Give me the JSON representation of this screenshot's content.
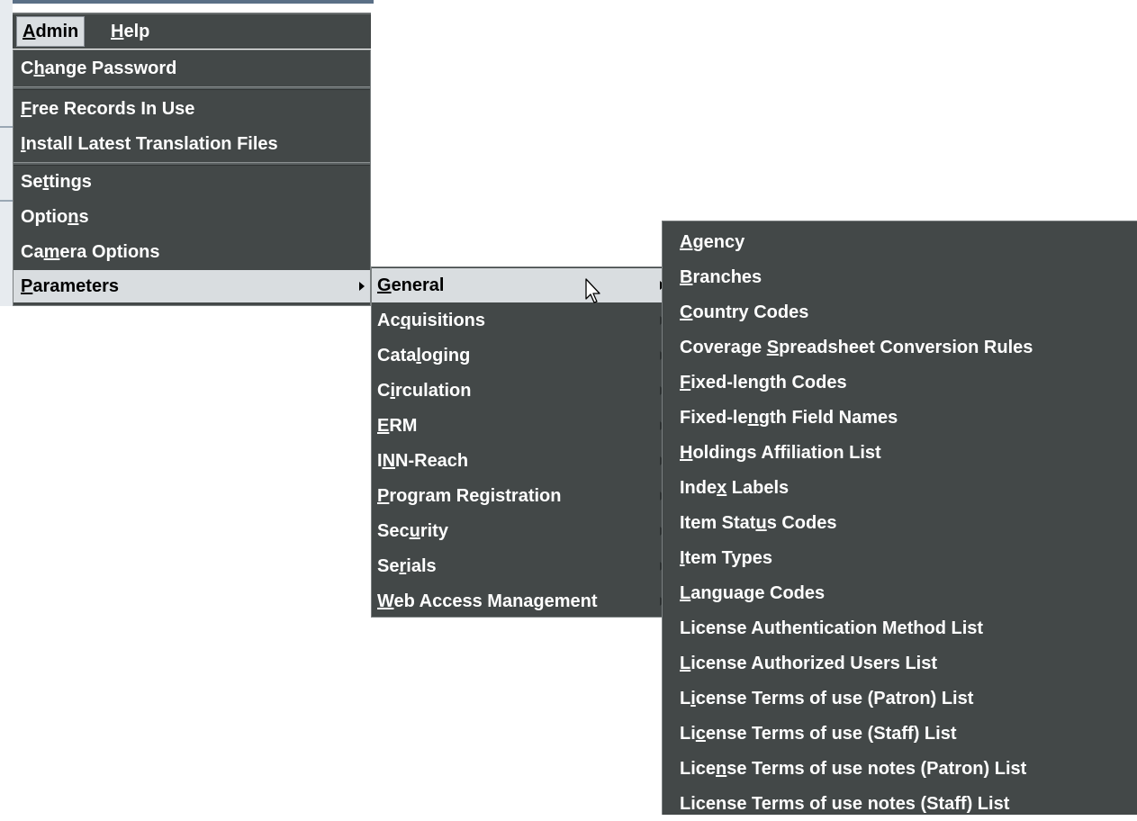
{
  "menubar": [
    {
      "pre": "",
      "mn": "A",
      "post": "dmin"
    },
    {
      "pre": "",
      "mn": "H",
      "post": "elp"
    }
  ],
  "admin_menu": {
    "change_password": {
      "pre": "C",
      "mn": "h",
      "post": "ange Password"
    },
    "free_records": {
      "pre": "",
      "mn": "F",
      "post": "ree Records In Use"
    },
    "install_translation": {
      "pre": "",
      "mn": "I",
      "post": "nstall Latest Translation Files"
    },
    "settings": {
      "pre": "Se",
      "mn": "t",
      "post": "tings"
    },
    "options": {
      "pre": "Optio",
      "mn": "n",
      "post": "s"
    },
    "camera_options": {
      "pre": "Ca",
      "mn": "m",
      "post": "era Options"
    },
    "parameters": {
      "pre": "",
      "mn": "P",
      "post": "arameters"
    }
  },
  "parameters_menu": [
    {
      "pre": "",
      "mn": "G",
      "post": "eneral"
    },
    {
      "pre": "Ac",
      "mn": "q",
      "post": "uisitions"
    },
    {
      "pre": "Cata",
      "mn": "l",
      "post": "oging"
    },
    {
      "pre": "C",
      "mn": "i",
      "post": "rculation"
    },
    {
      "pre": "",
      "mn": "E",
      "post": "RM"
    },
    {
      "pre": "I",
      "mn": "N",
      "post": "N-Reach"
    },
    {
      "pre": "",
      "mn": "P",
      "post": "rogram Registration"
    },
    {
      "pre": "Sec",
      "mn": "u",
      "post": "rity"
    },
    {
      "pre": "Se",
      "mn": "r",
      "post": "ials"
    },
    {
      "pre": "",
      "mn": "W",
      "post": "eb Access Management"
    }
  ],
  "general_menu": [
    {
      "pre": "",
      "mn": "A",
      "post": "gency"
    },
    {
      "pre": "",
      "mn": "B",
      "post": "ranches"
    },
    {
      "pre": "",
      "mn": "C",
      "post": "ountry Codes"
    },
    {
      "pre": "Coverage ",
      "mn": "S",
      "post": "preadsheet Conversion Rules"
    },
    {
      "pre": "",
      "mn": "F",
      "post": "ixed-length Codes"
    },
    {
      "pre": "Fixed-le",
      "mn": "n",
      "post": "gth Field Names"
    },
    {
      "pre": "",
      "mn": "H",
      "post": "oldings Affiliation List"
    },
    {
      "pre": "Inde",
      "mn": "x",
      "post": " Labels"
    },
    {
      "pre": "Item Stat",
      "mn": "u",
      "post": "s Codes"
    },
    {
      "pre": "",
      "mn": "I",
      "post": "tem Types"
    },
    {
      "pre": "",
      "mn": "L",
      "post": "anguage Codes"
    },
    {
      "pre": "License Authentication Method List",
      "mn": "",
      "post": ""
    },
    {
      "pre": "",
      "mn": "L",
      "post": "icense Authorized Users List"
    },
    {
      "pre": "L",
      "mn": "i",
      "post": "cense Terms of use (Patron) List"
    },
    {
      "pre": "Li",
      "mn": "c",
      "post": "ense Terms of use (Staff) List"
    },
    {
      "pre": "Lice",
      "mn": "n",
      "post": "se Terms of use notes (Patron) List"
    },
    {
      "pre": "License Terms of use notes (Staff) List",
      "mn": "",
      "post": ""
    }
  ],
  "colors": {
    "menu_bg": "#434848",
    "highlight_bg": "#d9dde0",
    "text": "#ffffff"
  },
  "icons": {
    "submenu_arrow": "triangle-right",
    "cursor": "arrow-pointer"
  }
}
